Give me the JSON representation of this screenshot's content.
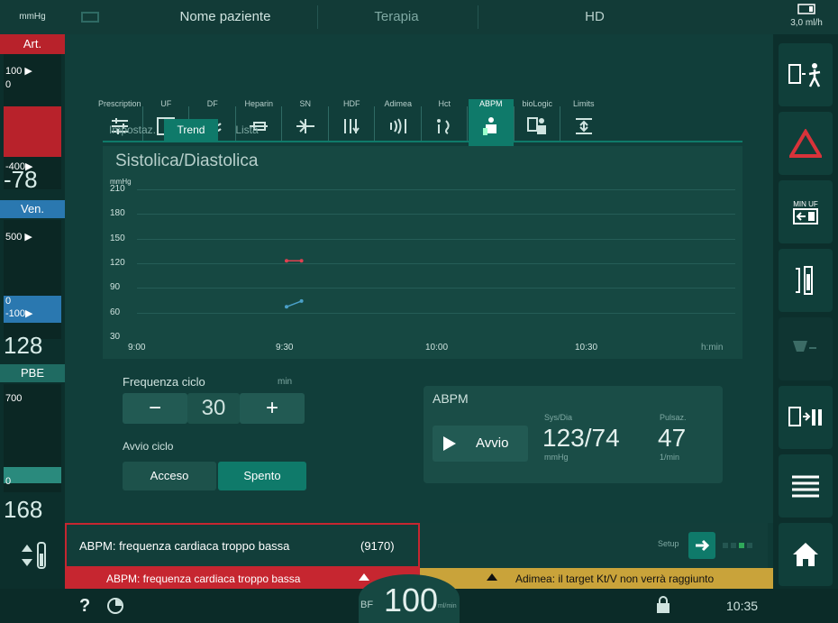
{
  "topbar": {
    "left_label": "mmHg",
    "patient": "Nome paziente",
    "therapy": "Terapia",
    "mode": "HD",
    "uf_rate": "3,0",
    "uf_unit": "ml/h"
  },
  "left": {
    "art_label": "Art.",
    "art_top": "100 ▶",
    "art_zero": "0",
    "art_bottom": "-400▶",
    "art_value": "-78",
    "ven_label": "Ven.",
    "ven_top": "500 ▶",
    "ven_zero": "0",
    "ven_bottom": "-100▶",
    "ven_value": "128",
    "pbe_label": "PBE",
    "pbe_top": "700",
    "pbe_zero": "0",
    "pbe_value": "168"
  },
  "tabs": [
    {
      "label": "Prescription",
      "icon": "prescription-icon"
    },
    {
      "label": "UF",
      "icon": "uf-icon"
    },
    {
      "label": "DF",
      "icon": "df-icon"
    },
    {
      "label": "Heparin",
      "icon": "heparin-icon"
    },
    {
      "label": "SN",
      "icon": "sn-icon"
    },
    {
      "label": "HDF",
      "icon": "hdf-icon"
    },
    {
      "label": "Adimea",
      "icon": "adimea-icon"
    },
    {
      "label": "Hct",
      "icon": "hct-icon"
    },
    {
      "label": "ABPM",
      "icon": "abpm-icon"
    },
    {
      "label": "bioLogic",
      "icon": "biologic-icon"
    },
    {
      "label": "Limits",
      "icon": "limits-icon"
    }
  ],
  "subtabs": [
    "Impostaz.",
    "Trend",
    "Lista"
  ],
  "chart_data": {
    "type": "line",
    "title": "Sistolica/Diastolica",
    "ylabel": "mmHg",
    "ylim": [
      30,
      210
    ],
    "yticks": [
      210,
      180,
      150,
      120,
      90,
      60,
      30
    ],
    "xticks": [
      "9:00",
      "9:30",
      "10:00",
      "10:30"
    ],
    "xunit": "h:min",
    "series": [
      {
        "values": [
          [
            9.5,
            123
          ],
          [
            9.55,
            123
          ]
        ],
        "color": "#e04050"
      },
      {
        "values": [
          [
            9.5,
            67
          ],
          [
            9.55,
            74
          ]
        ],
        "color": "#4aa0c8"
      }
    ]
  },
  "controls": {
    "cycle_label": "Frequenza ciclo",
    "cycle_unit": "min",
    "cycle_value": "30",
    "minus": "−",
    "plus": "+",
    "start_label": "Avvio ciclo",
    "on": "Acceso",
    "off": "Spento"
  },
  "abpm": {
    "title": "ABPM",
    "start_btn": "Avvio",
    "sys_label": "Sys/Dia",
    "sys_value": "123/74",
    "sys_unit": "mmHg",
    "pulse_label": "Pulsaz.",
    "pulse_value": "47",
    "pulse_unit": "1/min"
  },
  "alarm": {
    "message": "ABPM: frequenza cardiaca troppo bassa",
    "code": "(9170)",
    "banner": "ABPM: frequenza cardiaca troppo bassa",
    "warning": "Adimea: il target Kt/V non verrà raggiunto",
    "setup": "Setup"
  },
  "status": {
    "bf_label": "BF",
    "bf_value": "100",
    "bf_unit": "ml/min",
    "time": "10:35",
    "help": "?"
  },
  "right": {
    "min_uf": "MIN UF"
  },
  "colors": {
    "accent": "#0f7a6a",
    "alarm": "#c62630",
    "warning": "#c9a33a"
  }
}
